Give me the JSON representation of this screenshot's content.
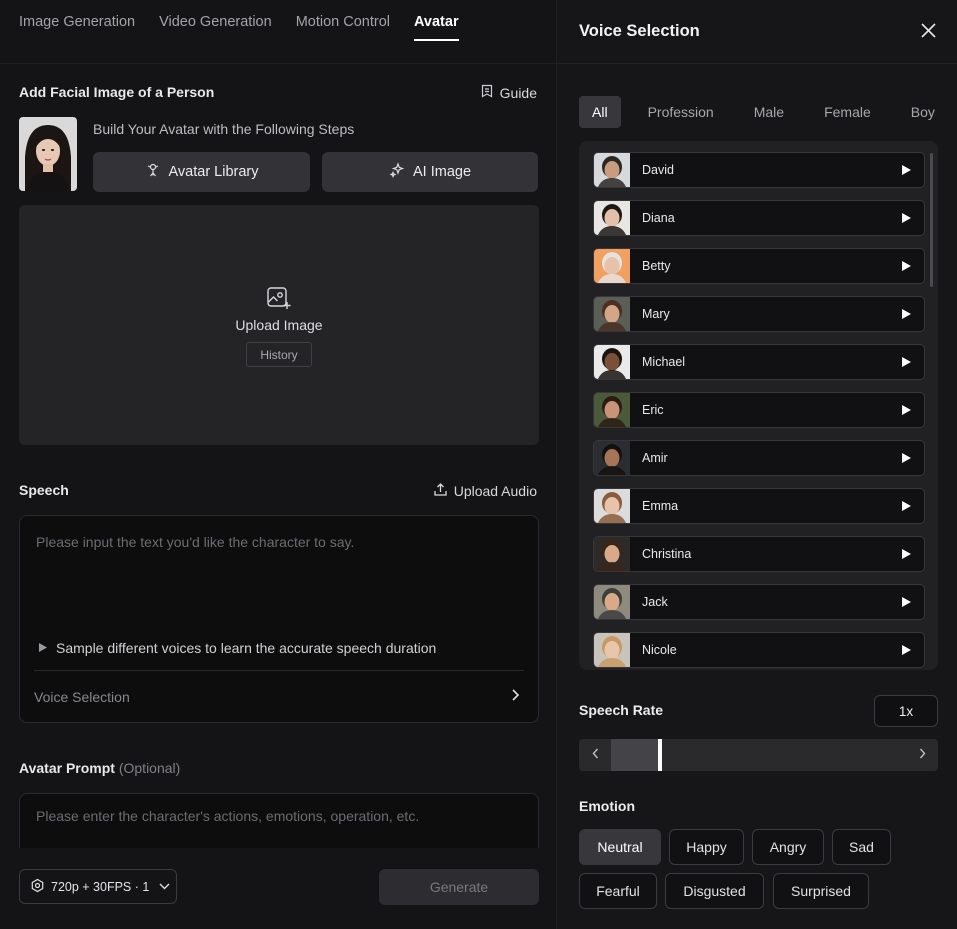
{
  "tabs": [
    {
      "label": "Image Generation",
      "active": false
    },
    {
      "label": "Video Generation",
      "active": false
    },
    {
      "label": "Motion Control",
      "active": false
    },
    {
      "label": "Avatar",
      "active": true
    }
  ],
  "face_section": {
    "title": "Add Facial Image of a Person",
    "guide_label": "Guide",
    "steps_text": "Build Your Avatar with the Following Steps",
    "avatar_library_label": "Avatar Library",
    "ai_image_label": "AI Image",
    "upload_label": "Upload Image",
    "history_label": "History"
  },
  "speech": {
    "title": "Speech",
    "upload_audio_label": "Upload Audio",
    "placeholder": "Please input the text you'd like the character to say.",
    "sample_hint": "Sample different voices to learn the accurate speech duration",
    "voice_selection_label": "Voice Selection"
  },
  "prompt": {
    "title": "Avatar Prompt",
    "optional": "(Optional)",
    "placeholder": "Please enter the character's actions, emotions, operation, etc."
  },
  "bottom": {
    "resolution": "720p + 30FPS · 1",
    "generate_label": "Generate"
  },
  "voice_panel": {
    "title": "Voice Selection",
    "filters": [
      {
        "label": "All",
        "active": true
      },
      {
        "label": "Profession",
        "active": false
      },
      {
        "label": "Male",
        "active": false
      },
      {
        "label": "Female",
        "active": false
      },
      {
        "label": "Boy",
        "active": false
      }
    ],
    "voices": [
      {
        "name": "David",
        "skin": "#c79c80",
        "hair": "#2b2622",
        "bg": "#d5d9dc"
      },
      {
        "name": "Diana",
        "skin": "#e2c0aa",
        "hair": "#1c1816",
        "bg": "#e8e6e3"
      },
      {
        "name": "Betty",
        "skin": "#e8c2a8",
        "hair": "#e6e3df",
        "bg": "#f0a060"
      },
      {
        "name": "Mary",
        "skin": "#d3a688",
        "hair": "#4a2f22",
        "bg": "#5a5e56"
      },
      {
        "name": "Michael",
        "skin": "#7b5038",
        "hair": "#1a1310",
        "bg": "#eaeaea"
      },
      {
        "name": "Eric",
        "skin": "#c89376",
        "hair": "#2a1c14",
        "bg": "#4a5a3a"
      },
      {
        "name": "Amir",
        "skin": "#a47557",
        "hair": "#15110e",
        "bg": "#2a2e33"
      },
      {
        "name": "Emma",
        "skin": "#e6c3aa",
        "hair": "#8a5b3a",
        "bg": "#dcdcdc"
      },
      {
        "name": "Christina",
        "skin": "#d8a98a",
        "hair": "#3a2519",
        "bg": "#2e2a28"
      },
      {
        "name": "Jack",
        "skin": "#d9a989",
        "hair": "#3d3d3d",
        "bg": "#8f8a7e"
      },
      {
        "name": "Nicole",
        "skin": "#e8c6ad",
        "hair": "#c89a62",
        "bg": "#c8c4bc"
      }
    ],
    "speech_rate_label": "Speech Rate",
    "speech_rate_value": "1x",
    "speech_rate_fraction": 0.16,
    "emotion_label": "Emotion",
    "emotions": [
      {
        "label": "Neutral",
        "active": true
      },
      {
        "label": "Happy",
        "active": false
      },
      {
        "label": "Angry",
        "active": false
      },
      {
        "label": "Sad",
        "active": false
      },
      {
        "label": "Fearful",
        "active": false
      },
      {
        "label": "Disgusted",
        "active": false
      },
      {
        "label": "Surprised",
        "active": false
      }
    ]
  },
  "colors": {
    "panel_left": "#141416",
    "panel_right": "#161618",
    "chip_active": "#38383c",
    "text_primary": "#e6e6e8"
  }
}
